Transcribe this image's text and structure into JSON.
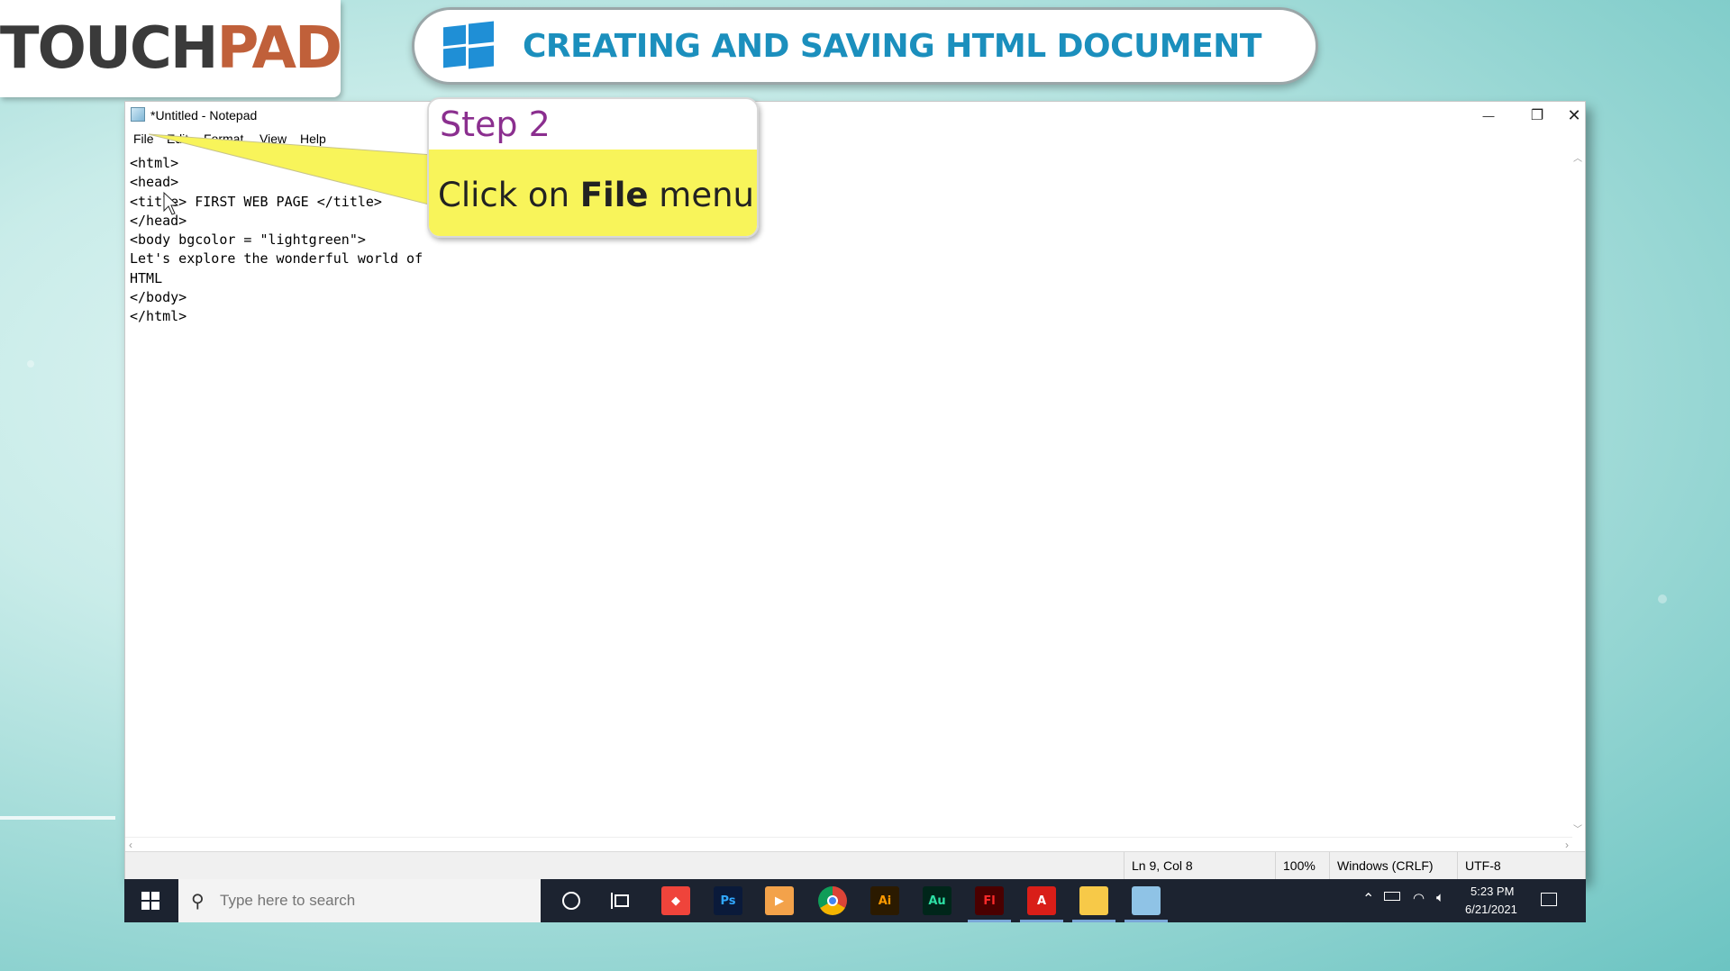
{
  "logo": {
    "part1": "TOUCH",
    "part2": "PAD"
  },
  "banner": {
    "title": "CREATING AND SAVING HTML DOCUMENT"
  },
  "window": {
    "title": "*Untitled - Notepad",
    "menu": [
      "File",
      "Edit",
      "Format",
      "View",
      "Help"
    ],
    "controls": {
      "minimize": "—",
      "restore": "❐",
      "close": "✕"
    },
    "content": "<html>\n<head>\n<title> FIRST WEB PAGE </title>\n</head>\n<body bgcolor = \"lightgreen\">\nLet's explore the wonderful world of\nHTML\n</body>\n</html>",
    "status": {
      "position": "Ln 9, Col 8",
      "zoom": "100%",
      "line_ending": "Windows (CRLF)",
      "encoding": "UTF-8"
    }
  },
  "callout": {
    "step": "Step 2",
    "text_prefix": "Click on ",
    "text_bold": "File",
    "text_suffix": " menu"
  },
  "taskbar": {
    "search_placeholder": "Type here to search",
    "apps": [
      {
        "name": "anydesk-icon",
        "label": "◆",
        "bg": "#ef443b",
        "fg": "#ffffff"
      },
      {
        "name": "photoshop-icon",
        "label": "Ps",
        "bg": "#0a1a3a",
        "fg": "#31a8ff"
      },
      {
        "name": "media-player-icon",
        "label": "▶",
        "bg": "#f3a24a",
        "fg": "#ffffff"
      },
      {
        "name": "chrome-icon",
        "label": "",
        "bg": "#1c2330",
        "fg": "#ffffff"
      },
      {
        "name": "illustrator-icon",
        "label": "Ai",
        "bg": "#2b1a00",
        "fg": "#ff9a00"
      },
      {
        "name": "audition-icon",
        "label": "Au",
        "bg": "#00261a",
        "fg": "#2de0a5"
      },
      {
        "name": "flash-icon",
        "label": "Fl",
        "bg": "#4a0000",
        "fg": "#ff2a2a"
      },
      {
        "name": "acrobat-icon",
        "label": "A",
        "bg": "#d91e18",
        "fg": "#ffffff"
      },
      {
        "name": "file-explorer-icon",
        "label": "",
        "bg": "#f7c948",
        "fg": "#ffffff"
      },
      {
        "name": "notepad-icon",
        "label": "",
        "bg": "#8fc3e6",
        "fg": "#ffffff"
      }
    ],
    "time": "5:23 PM",
    "date": "6/21/2021"
  }
}
